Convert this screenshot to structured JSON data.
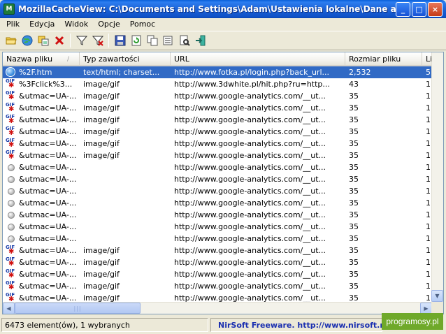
{
  "window": {
    "icon_label": "M",
    "title": "MozillaCacheView:   C:\\Documents and Settings\\Adam\\Ustawienia lokalne\\Dane aplikacj...",
    "minimize": "_",
    "maximize": "□",
    "close": "×"
  },
  "menu": [
    "Plik",
    "Edycja",
    "Widok",
    "Opcje",
    "Pomoc"
  ],
  "columns": {
    "name": "Nazwa pliku",
    "type": "Typ zawartości",
    "url": "URL",
    "size": "Rozmiar pliku",
    "last": "Li"
  },
  "rows": [
    {
      "icon": "html",
      "name": "%2F.htm",
      "type": "text/html; charset...",
      "url": "http://www.fotka.pl/login.php?back_url...",
      "size": "2,532",
      "last": "5",
      "selected": true
    },
    {
      "icon": "gif",
      "name": "%3Fclick%3...",
      "type": "image/gif",
      "url": "http://www.3dwhite.pl/hit.php?ru=http...",
      "size": "43",
      "last": "1"
    },
    {
      "icon": "gif",
      "name": "&utmac=UA-...",
      "type": "image/gif",
      "url": "http://www.google-analytics.com/__ut...",
      "size": "35",
      "last": "1"
    },
    {
      "icon": "gif",
      "name": "&utmac=UA-...",
      "type": "image/gif",
      "url": "http://www.google-analytics.com/__ut...",
      "size": "35",
      "last": "1"
    },
    {
      "icon": "gif",
      "name": "&utmac=UA-...",
      "type": "image/gif",
      "url": "http://www.google-analytics.com/__ut...",
      "size": "35",
      "last": "1"
    },
    {
      "icon": "gif",
      "name": "&utmac=UA-...",
      "type": "image/gif",
      "url": "http://www.google-analytics.com/__ut...",
      "size": "35",
      "last": "1"
    },
    {
      "icon": "gif",
      "name": "&utmac=UA-...",
      "type": "image/gif",
      "url": "http://www.google-analytics.com/__ut...",
      "size": "35",
      "last": "1"
    },
    {
      "icon": "gif",
      "name": "&utmac=UA-...",
      "type": "image/gif",
      "url": "http://www.google-analytics.com/__ut...",
      "size": "35",
      "last": "1"
    },
    {
      "icon": "dot",
      "name": "&utmac=UA-...",
      "type": "",
      "url": "http://www.google-analytics.com/__ut...",
      "size": "35",
      "last": "1"
    },
    {
      "icon": "dot",
      "name": "&utmac=UA-...",
      "type": "",
      "url": "http://www.google-analytics.com/__ut...",
      "size": "35",
      "last": "1"
    },
    {
      "icon": "dot",
      "name": "&utmac=UA-...",
      "type": "",
      "url": "http://www.google-analytics.com/__ut...",
      "size": "35",
      "last": "1"
    },
    {
      "icon": "dot",
      "name": "&utmac=UA-...",
      "type": "",
      "url": "http://www.google-analytics.com/__ut...",
      "size": "35",
      "last": "1"
    },
    {
      "icon": "dot",
      "name": "&utmac=UA-...",
      "type": "",
      "url": "http://www.google-analytics.com/__ut...",
      "size": "35",
      "last": "1"
    },
    {
      "icon": "dot",
      "name": "&utmac=UA-...",
      "type": "",
      "url": "http://www.google-analytics.com/__ut...",
      "size": "35",
      "last": "1"
    },
    {
      "icon": "dot",
      "name": "&utmac=UA-...",
      "type": "",
      "url": "http://www.google-analytics.com/__ut...",
      "size": "35",
      "last": "1"
    },
    {
      "icon": "gif",
      "name": "&utmac=UA-...",
      "type": "image/gif",
      "url": "http://www.google-analytics.com/__ut...",
      "size": "35",
      "last": "1"
    },
    {
      "icon": "gif",
      "name": "&utmac=UA-...",
      "type": "image/gif",
      "url": "http://www.google-analytics.com/__ut...",
      "size": "35",
      "last": "1"
    },
    {
      "icon": "gif",
      "name": "&utmac=UA-...",
      "type": "image/gif",
      "url": "http://www.google-analytics.com/__ut...",
      "size": "35",
      "last": "1"
    },
    {
      "icon": "gif",
      "name": "&utmac=UA-...",
      "type": "image/gif",
      "url": "http://www.google-analytics.com/__ut...",
      "size": "35",
      "last": "1"
    },
    {
      "icon": "gif",
      "name": "&utmac=UA-...",
      "type": "image/gif",
      "url": "http://www.google-analytics.com/__ut...",
      "size": "35",
      "last": "1"
    }
  ],
  "gif_icon_label": "GIF",
  "status": {
    "count": "6473 element(ów), 1 wybranych",
    "vendor": "NirSoft Freeware.  http://www.nirsoft.net"
  },
  "watermark": "programosy.pl",
  "colors": {
    "selection": "#316ac5",
    "titlebar": "#0f52c9",
    "vendor_link": "#1a2fb0"
  }
}
